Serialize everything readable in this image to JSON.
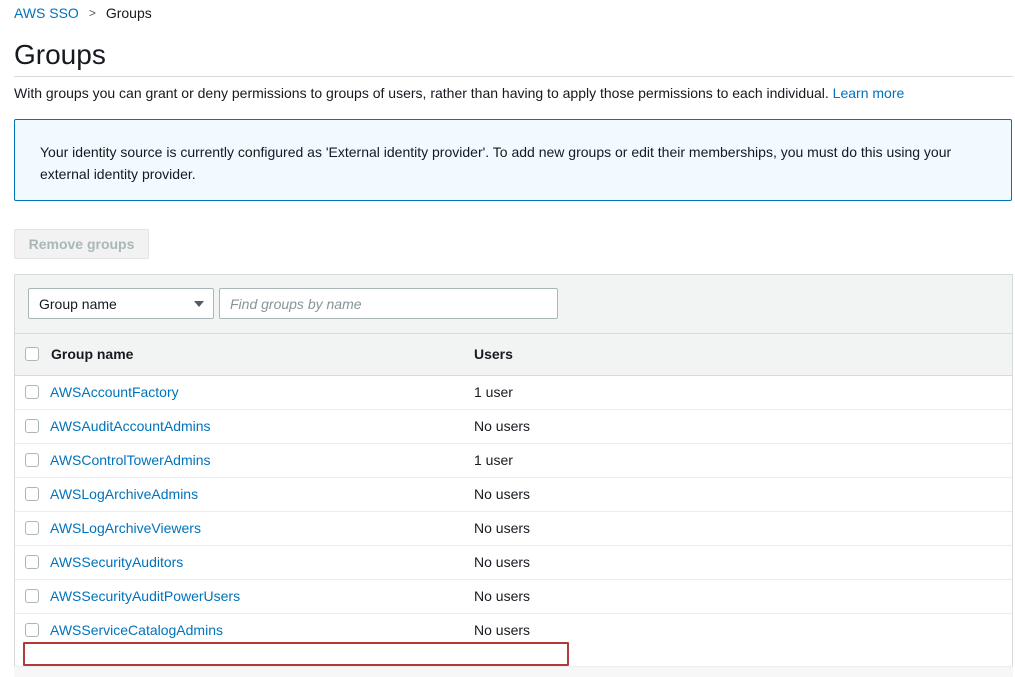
{
  "breadcrumb": {
    "root": "AWS SSO",
    "separator": ">",
    "current": "Groups"
  },
  "page": {
    "title": "Groups",
    "description": "With groups you can grant or deny permissions to groups of users, rather than having to apply those permissions to each individual.",
    "learn_more": "Learn more"
  },
  "alert": {
    "type": "info",
    "text": "Your identity source is currently configured as 'External identity provider'. To add new groups or edit their memberships, you must do this using your external identity provider."
  },
  "actions": {
    "remove_groups": "Remove groups",
    "remove_groups_enabled": false
  },
  "filter": {
    "property_selected": "Group name",
    "search_placeholder": "Find groups by name"
  },
  "table": {
    "columns": [
      "Group name",
      "Users"
    ],
    "rows": [
      {
        "name": "AWSAccountFactory",
        "users": "1 user"
      },
      {
        "name": "AWSAuditAccountAdmins",
        "users": "No users"
      },
      {
        "name": "AWSControlTowerAdmins",
        "users": "1 user"
      },
      {
        "name": "AWSLogArchiveAdmins",
        "users": "No users"
      },
      {
        "name": "AWSLogArchiveViewers",
        "users": "No users"
      },
      {
        "name": "AWSSecurityAuditors",
        "users": "No users"
      },
      {
        "name": "AWSSecurityAuditPowerUsers",
        "users": "No users"
      },
      {
        "name": "AWSServiceCatalogAdmins",
        "users": "No users"
      }
    ]
  },
  "colors": {
    "link": "#0073bb",
    "alert_border": "#0073bb",
    "alert_background": "#f1faff",
    "highlight": "#b03a3a"
  }
}
